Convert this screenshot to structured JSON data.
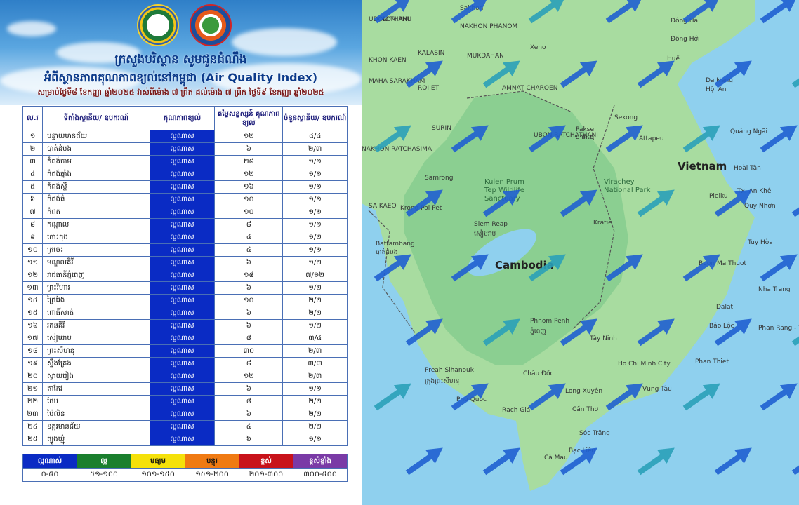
{
  "header": {
    "title1": "ក្រសួងបរិស្ថាន សូមជូនដំណឹង",
    "title2": "អំពីស្ថានភាពគុណភាពខ្យល់នៅកម្ពុជា (Air Quality Index)",
    "title3": "សម្រាប់ថ្ងៃទី៨ ខែកញ្ញា ឆ្នាំ២០២៥ វាស់ពីម៉ោង ៧ ព្រឹក ដល់ម៉ោង ៧ ព្រឹក ថ្ងៃទី៩ ខែកញ្ញា ឆ្នាំ២០២៥"
  },
  "table": {
    "headers": [
      "ល.រ",
      "ទីតាំងស្ថានីយ/ ឧបករណ៍",
      "គុណភាពខ្យល់",
      "តម្លៃសន្ទស្សន៍ គុណភាពខ្យល់",
      "ចំនួនស្ថានីយ/ ឧបករណ៍"
    ],
    "rows": [
      [
        "១",
        "បន្ទាយមានជ័យ",
        "ល្អណាស់",
        "១២",
        "៤/៤"
      ],
      [
        "២",
        "បាត់ដំបង",
        "ល្អណាស់",
        "៦",
        "២/៣"
      ],
      [
        "៣",
        "កំពង់ចាម",
        "ល្អណាស់",
        "២៨",
        "១/១"
      ],
      [
        "៤",
        "កំពង់ឆ្នាំង",
        "ល្អណាស់",
        "១២",
        "១/១"
      ],
      [
        "៥",
        "កំពង់ស្ពឺ",
        "ល្អណាស់",
        "១៦",
        "១/១"
      ],
      [
        "៦",
        "កំពង់ធំ",
        "ល្អណាស់",
        "១០",
        "១/១"
      ],
      [
        "៧",
        "កំពត",
        "ល្អណាស់",
        "១០",
        "១/១"
      ],
      [
        "៨",
        "កណ្ដាល",
        "ល្អណាស់",
        "៨",
        "១/១"
      ],
      [
        "៩",
        "កោះកុង",
        "ល្អណាស់",
        "៤",
        "១/២"
      ],
      [
        "១០",
        "ក្រចេះ",
        "ល្អណាស់",
        "៤",
        "១/១"
      ],
      [
        "១១",
        "មណ្ឌលគិរី",
        "ល្អណាស់",
        "៦",
        "១/២"
      ],
      [
        "១២",
        "រាជធានីភ្នំពេញ",
        "ល្អណាស់",
        "១៨",
        "៧/១២"
      ],
      [
        "១៣",
        "ព្រះវិហារ",
        "ល្អណាស់",
        "៦",
        "១/២"
      ],
      [
        "១៤",
        "ព្រៃវែង",
        "ល្អណាស់",
        "១០",
        "២/២"
      ],
      [
        "១៥",
        "ពោធិ៍សាត់",
        "ល្អណាស់",
        "៦",
        "២/២"
      ],
      [
        "១៦",
        "រតនគិរី",
        "ល្អណាស់",
        "៦",
        "១/២"
      ],
      [
        "១៧",
        "សៀមរាប",
        "ល្អណាស់",
        "៨",
        "៣/៤"
      ],
      [
        "១៨",
        "ព្រះសីហនុ",
        "ល្អណាស់",
        "៣០",
        "២/៣"
      ],
      [
        "១៩",
        "ស្ទឹងត្រែង",
        "ល្អណាស់",
        "៨",
        "៣/៣"
      ],
      [
        "២០",
        "ស្វាយរៀង",
        "ល្អណាស់",
        "១២",
        "២/៣"
      ],
      [
        "២១",
        "តាកែវ",
        "ល្អណាស់",
        "៦",
        "១/១"
      ],
      [
        "២២",
        "កែប",
        "ល្អណាស់",
        "៨",
        "២/២"
      ],
      [
        "២៣",
        "ប៉ៃលិន",
        "ល្អណាស់",
        "៦",
        "២/២"
      ],
      [
        "២៤",
        "ឧត្ដរមានជ័យ",
        "ល្អណាស់",
        "៤",
        "២/២"
      ],
      [
        "២៥",
        "ត្បូងឃ្មុំ",
        "ល្អណាស់",
        "៦",
        "១/១"
      ]
    ]
  },
  "legend": [
    {
      "label": "ល្អណាស់",
      "range": "០-៥០",
      "color": "#0a2bc4",
      "text": "#ffffff"
    },
    {
      "label": "ល្អ",
      "range": "៥១-១០០",
      "color": "#1a7f2e",
      "text": "#ffffff"
    },
    {
      "label": "មធ្យម",
      "range": "១០១-១៥០",
      "color": "#f5e10a",
      "text": "#111111"
    },
    {
      "label": "បន្ទុរ",
      "range": "១៥១-២០០",
      "color": "#f07a12",
      "text": "#111111"
    },
    {
      "label": "ខ្ពស់",
      "range": "២០១-៣០០",
      "color": "#c8121a",
      "text": "#ffffff"
    },
    {
      "label": "ខ្ពស់ខ្លាំង",
      "range": "៣០០-៥០០",
      "color": "#7a3aa6",
      "text": "#ffffff"
    }
  ],
  "map": {
    "country_labels": {
      "cambodia": "Cambodia",
      "vietnam": "Vietnam"
    },
    "parks": {
      "kulen": "Kulen Prum\nTep Wildlife\nSanctuary",
      "virachey": "Virachey\nNational Park"
    },
    "cities": [
      "Phnom Penh",
      "ភ្នំពេញ",
      "Siem Reap",
      "សៀមរាប",
      "Battambang",
      "បាត់ដំបង",
      "Pakse",
      "ປາກເຊ",
      "Sekong",
      "Attapeu",
      "Da Nang",
      "Hội An",
      "Huế",
      "Quảng Ngãi",
      "Pleiku",
      "Quy Nhơn",
      "Tuy Hòa",
      "Buon Ma Thuot",
      "Nha Trang",
      "Dalat",
      "Bảo Lộc",
      "Phan Thiet",
      "Ho Chi Minh City",
      "Vũng Tàu",
      "Long Xuyên",
      "Cần Thơ",
      "Rạch Giá",
      "Phú Quốc",
      "Châu Đốc",
      "Tây Ninh",
      "Sóc Trăng",
      "Bạc Liêu",
      "Cà Mau",
      "Kratie",
      "Tx. An Khê",
      "Hoài Tân",
      "Đông Hà",
      "Đồng Hới",
      "Sakhon",
      "NAKHON PHANOM",
      "MUKDAHAN",
      "KALASIN",
      "KHON KAEN",
      "MAHA SARAKHAM",
      "ROI ET",
      "AMNAT CHAROEN",
      "SURIN",
      "UBON RATCHATHANI",
      "SA KAEO",
      "NAKHON RATCHASIMA",
      "Samrong",
      "Krong Poi Pet",
      "Xeno",
      "UDON THANI",
      "LOM PHU",
      "Preah Sihanouk",
      "ក្រុងព្រះសីហនុ",
      "Phan Rang - Tháp Chàm"
    ]
  }
}
